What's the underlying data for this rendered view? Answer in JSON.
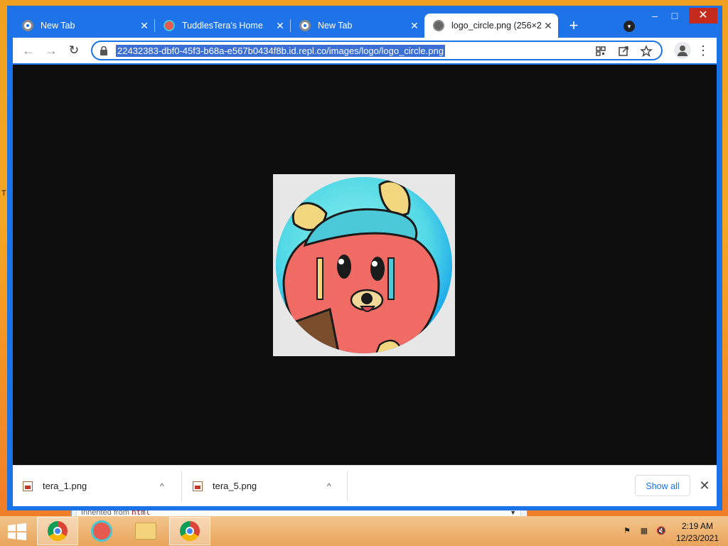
{
  "desktop": {
    "edge_text": "T"
  },
  "background_window": {
    "row_label": "Inherited from",
    "row_keyword": "html"
  },
  "tabs": [
    {
      "title": "New Tab",
      "favicon": "chrome-icon"
    },
    {
      "title": "TuddlesTera's Home",
      "favicon": "tera-logo-icon"
    },
    {
      "title": "New Tab",
      "favicon": "chrome-icon"
    },
    {
      "title": "logo_circle.png (256×2",
      "favicon": "globe-icon",
      "active": true
    }
  ],
  "controls": {
    "new_tab": "+",
    "tab_search": "▾",
    "minimize": "–",
    "maximize": "□",
    "close": "✕",
    "tab_close": "✕"
  },
  "toolbar": {
    "back": "←",
    "forward": "→",
    "reload": "↻",
    "url": "22432383-dbf0-45f3-b68a-e567b0434f8b.id.repl.co/images/logo/logo_circle.png",
    "menu": "⋮"
  },
  "downloads": {
    "items": [
      {
        "filename": "tera_1.png"
      },
      {
        "filename": "tera_5.png"
      }
    ],
    "show_all": "Show all",
    "close": "✕",
    "caret": "^"
  },
  "taskbar": {
    "clock_time": "2:19 AM",
    "clock_date": "12/23/2021"
  },
  "colors": {
    "chrome_blue": "#1a73e8",
    "viewer_bg": "#0e0e0e",
    "close_red": "#c42b1c"
  }
}
